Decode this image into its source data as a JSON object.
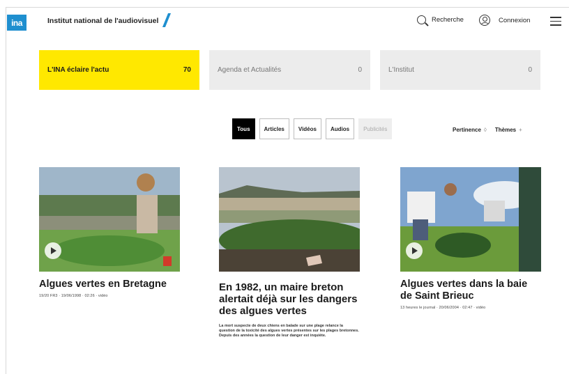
{
  "header": {
    "logo_text": "ina",
    "site_name": "Institut national de l'audiovisuel",
    "search_label": "Recherche",
    "login_label": "Connexion",
    "brand_color": "#1f8fcf",
    "icons": [
      "search-icon",
      "user-icon",
      "menu-icon"
    ]
  },
  "tabs": [
    {
      "label": "L'INA éclaire l'actu",
      "count": "70",
      "active": true
    },
    {
      "label": "Agenda et Actualités",
      "count": "0",
      "active": false
    },
    {
      "label": "L'Institut",
      "count": "0",
      "active": false
    }
  ],
  "filters": [
    {
      "label": "Tous",
      "state": "selected"
    },
    {
      "label": "Articles",
      "state": "default"
    },
    {
      "label": "Vidéos",
      "state": "default"
    },
    {
      "label": "Audios",
      "state": "default"
    },
    {
      "label": "Publicités",
      "state": "disabled"
    }
  ],
  "sort": {
    "label": "Pertinence",
    "toggle_symbol": "◊",
    "themes_label": "Thèmes",
    "themes_symbol": "+"
  },
  "cards": [
    {
      "title": "Algues vertes en Bretagne",
      "meta": "19/20 FR3 · 19/06/1998 · 02:26 · vidéo",
      "description": ""
    },
    {
      "title": "En 1982, un maire breton alertait déjà sur les dangers des algues vertes",
      "meta": "",
      "description": "La mort suspecte de deux chiens en balade sur une plage relance la question de la toxicité des algues vertes présentes sur les plages bretonnes. Depuis des années la question de leur danger est inquiète."
    },
    {
      "title": "Algues vertes dans la baie de Saint Brieuc",
      "meta": "13 heures le journal · 20/06/2004 · 02:47 · vidéo",
      "description": ""
    }
  ],
  "colors": {
    "active_tab": "#ffe800",
    "inactive_tab": "#ececec"
  }
}
